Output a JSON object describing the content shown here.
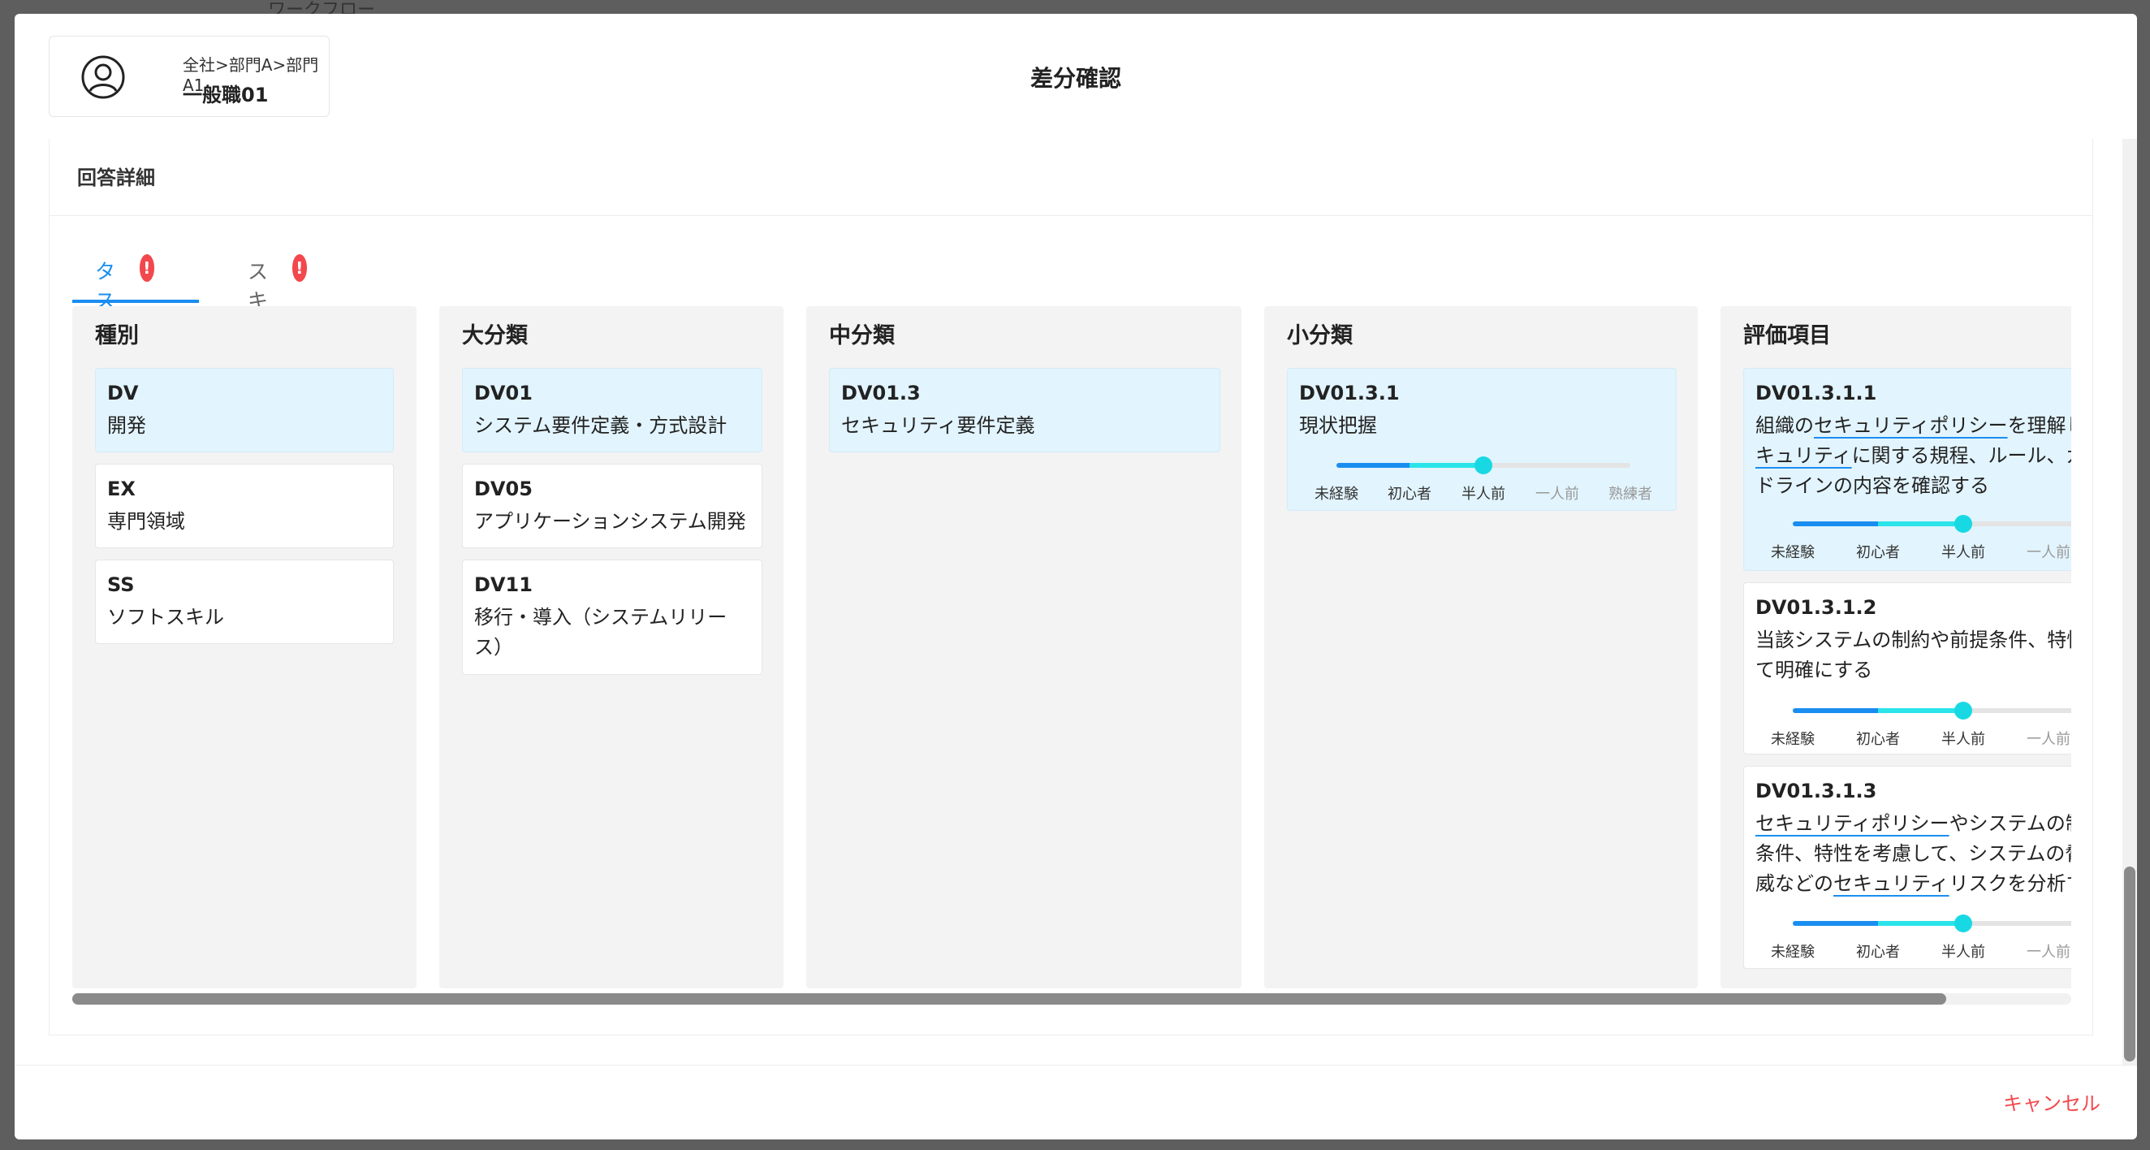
{
  "background": {
    "hint_text": "ワークフロー"
  },
  "header": {
    "user_path": "全社>部門A>部門A1",
    "user_name": "一般職01",
    "title": "差分確認"
  },
  "detail": {
    "title": "回答詳細",
    "tabs": [
      {
        "label": "タスク",
        "badge": "!"
      },
      {
        "label": "スキル",
        "badge": "!"
      }
    ]
  },
  "columns": {
    "type": {
      "title": "種別",
      "items": [
        {
          "code": "DV",
          "name": "開発"
        },
        {
          "code": "EX",
          "name": "専門領域"
        },
        {
          "code": "SS",
          "name": "ソフトスキル"
        }
      ]
    },
    "major": {
      "title": "大分類",
      "items": [
        {
          "code": "DV01",
          "name": "システム要件定義・方式設計"
        },
        {
          "code": "DV05",
          "name": "アプリケーションシステム開発"
        },
        {
          "code": "DV11",
          "name_line1": "移行・導入（システムリリー",
          "name_line2": "ス）"
        }
      ]
    },
    "middle": {
      "title": "中分類",
      "items": [
        {
          "code": "DV01.3",
          "name": "セキュリティ要件定義"
        }
      ]
    },
    "minor": {
      "title": "小分類",
      "items": [
        {
          "code": "DV01.3.1",
          "name": "現状把握",
          "level": 2
        }
      ],
      "levels": [
        "未経験",
        "初心者",
        "半人前",
        "一人前",
        "熟練者"
      ]
    },
    "evaluation": {
      "title": "評価項目",
      "items": [
        {
          "code": "DV01.3.1.1",
          "l1a": "組織の",
          "l1b": "セキュリティポリシー",
          "l1c": "を理解し",
          "l2a": "キュリティ",
          "l2b": "に関する規程、ルール、ガ",
          "l3": "ドラインの内容を確認する",
          "level": 2
        },
        {
          "code": "DV01.3.1.2",
          "l1": "当該システムの制約や前提条件、特性",
          "l2": "て明確にする",
          "level": 2
        },
        {
          "code": "DV01.3.1.3",
          "l1a": "セキュリティポリシー",
          "l1b": "やシステムの制",
          "l2": "条件、特性を考慮して、システムの脅",
          "l3a": "威などの",
          "l3b": "セキュリティ",
          "l3c": "リスクを分析す",
          "level": 2
        }
      ],
      "levels": [
        "未経験",
        "初心者",
        "半人前",
        "一人前"
      ]
    }
  },
  "footer": {
    "cancel_label": "キャンセル"
  },
  "colors": {
    "accent": "#1a8ef0",
    "slider_fill": "#2ae4ea",
    "danger": "#f2484d",
    "selected_bg": "#e2f4fd"
  }
}
